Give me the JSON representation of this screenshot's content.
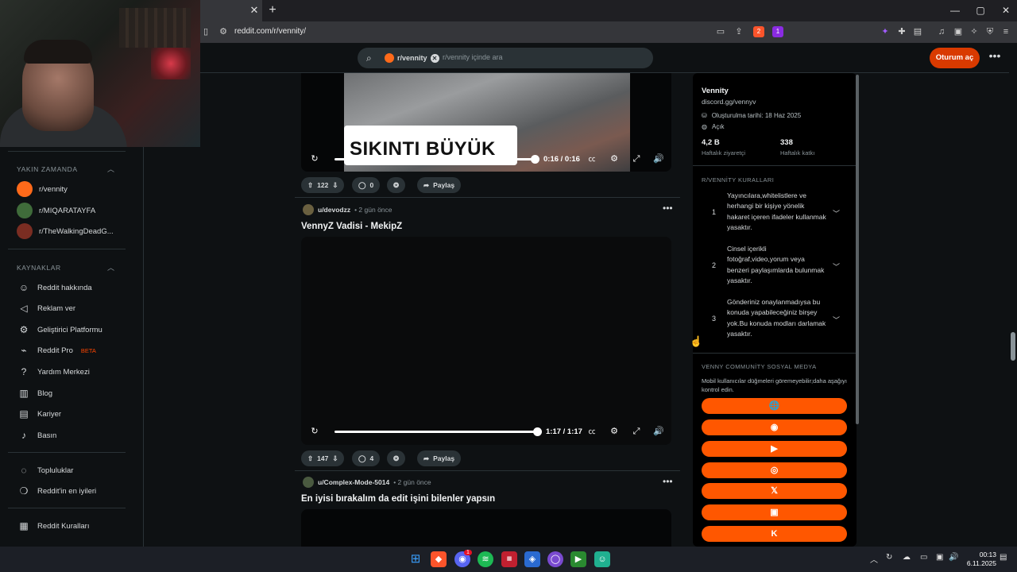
{
  "browser": {
    "tab_close": "✕",
    "new_tab": "+",
    "url": "reddit.com/r/vennity/",
    "brave_shield_count": "2",
    "brave_rewards_count": "1",
    "window": {
      "minimize": "—",
      "maximize": "▢",
      "close": "✕"
    }
  },
  "header": {
    "search_chip_label": "r/vennity",
    "search_placeholder": "r/vennity içinde ara",
    "login_label": "Oturum aç",
    "more_label": "•••"
  },
  "left_sidebar": {
    "recent_title": "YAKIN ZAMANDA",
    "recent": [
      {
        "label": "r/vennity",
        "color": "#ff6a1a"
      },
      {
        "label": "r/MIQARATAYFA",
        "color": "#3f6b3a"
      },
      {
        "label": "r/TheWalkingDeadG...",
        "color": "#7a2d22"
      }
    ],
    "resources_title": "KAYNAKLAR",
    "resources": [
      {
        "label": "Reddit hakkında",
        "icon": "reddit-alien-icon"
      },
      {
        "label": "Reklam ver",
        "icon": "megaphone-icon"
      },
      {
        "label": "Geliştirici Platformu",
        "icon": "gear-icon"
      },
      {
        "label": "Reddit Pro",
        "icon": "pro-icon",
        "badge": "BETA"
      },
      {
        "label": "Yardım Merkezi",
        "icon": "help-icon"
      },
      {
        "label": "Blog",
        "icon": "book-icon"
      },
      {
        "label": "Kariyer",
        "icon": "briefcase-icon"
      },
      {
        "label": "Basın",
        "icon": "microphone-icon"
      }
    ],
    "more": [
      {
        "label": "Topluluklar",
        "icon": "communities-icon"
      },
      {
        "label": "Reddit'in en iyileri",
        "icon": "best-of-icon"
      }
    ],
    "rules_link": {
      "label": "Reddit Kuralları",
      "icon": "rules-icon"
    }
  },
  "posts": [
    {
      "overlay_text": "SIKINTI BÜYÜK",
      "time": "0:16 / 0:16",
      "progress": 1.0,
      "upvotes": "122",
      "comments": "0",
      "share_label": "Paylaş"
    },
    {
      "user": "u/devodzz",
      "age": "• 2 gün önce",
      "title": "VennyZ Vadisi - MekipZ",
      "time": "1:17 / 1:17",
      "progress": 1.0,
      "upvotes": "147",
      "comments": "4",
      "share_label": "Paylaş"
    },
    {
      "user": "u/Complex-Mode-5014",
      "age": "• 2 gün önce",
      "title": "En iyisi bırakalım da edit işini bilenler yapsın"
    }
  ],
  "right_sidebar": {
    "name": "Vennity",
    "link": "discord.gg/vennyv",
    "created": "Oluşturulma tarihi: 18 Haz 2025",
    "status": "Açık",
    "stat1_value": "4,2 B",
    "stat1_label": "Haftalık ziyaretçi",
    "stat2_value": "338",
    "stat2_label": "Haftalık katkı",
    "rules_title": "R/VENNİTY KURALLARI",
    "rules": [
      {
        "num": "1",
        "text": "Yayıncılara,whitelistlere ve herhangi bir kişiye yönelik hakaret içeren ifadeler kullanmak yasaktır."
      },
      {
        "num": "2",
        "text": "Cinsel içerikli fotoğraf,video,yorum veya benzeri paylaşımlarda bulunmak yasaktır."
      },
      {
        "num": "3",
        "text": "Gönderiniz onaylanmadıysa bu konuda yapabileceğiniz birşey yok.Bu konuda modları darlamak yasaktır."
      }
    ],
    "social_title": "VENNY COMMUNİTY SOSYAL MEDYA",
    "social_note": "Mobil kullanıcılar düğmeleri göremeyebilir;daha aşağıyı kontrol edin.",
    "social_buttons": [
      {
        "icon": "globe-icon",
        "glyph": "🌐"
      },
      {
        "icon": "discord-icon",
        "glyph": "◉"
      },
      {
        "icon": "youtube-icon",
        "glyph": "▶"
      },
      {
        "icon": "instagram-icon",
        "glyph": "◎"
      },
      {
        "icon": "x-icon",
        "glyph": "𝕏"
      },
      {
        "icon": "twitch-icon",
        "glyph": "▣"
      },
      {
        "icon": "kick-icon",
        "glyph": "K"
      }
    ]
  },
  "taskbar": {
    "clock_time": "00:13",
    "clock_date": "6.11.2025",
    "discord_badge": "1"
  }
}
